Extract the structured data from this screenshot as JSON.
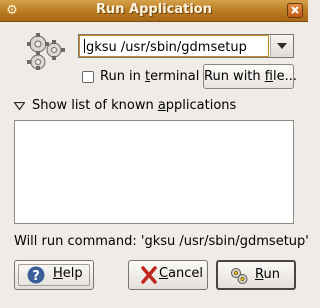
{
  "window": {
    "title": "Run Application",
    "menu_icon": "window-menu-icon",
    "close_icon": "close-icon"
  },
  "command": {
    "value": "gksu /usr/sbin/gdmsetup",
    "icon": "gears-application-icon",
    "dropdown_icon": "chevron-down-icon"
  },
  "terminal": {
    "label_pre": "Run in ",
    "label_underline": "t",
    "label_post": "erminal",
    "checked": false
  },
  "run_with_file": {
    "label_pre": "Run with ",
    "label_underline": "f",
    "label_post": "ile..."
  },
  "known_apps": {
    "label_pre": "Show list of known ",
    "label_underline": "a",
    "label_post": "pplications",
    "expander_icon": "expander-arrow-icon"
  },
  "status": {
    "text": "Will run command: 'gksu /usr/sbin/gdmsetup'"
  },
  "buttons": {
    "help": {
      "label_underline": "H",
      "label_post": "elp",
      "icon": "help-icon"
    },
    "cancel": {
      "label_underline": "C",
      "label_post": "ancel",
      "icon": "cancel-icon"
    },
    "run": {
      "label_pre": "",
      "label_underline": "R",
      "label_post": "un",
      "icon": "run-icon"
    }
  },
  "colors": {
    "titlebar": "#b97a1e",
    "window_bg": "#efebe7",
    "focus_accent": "#c58a2a"
  }
}
